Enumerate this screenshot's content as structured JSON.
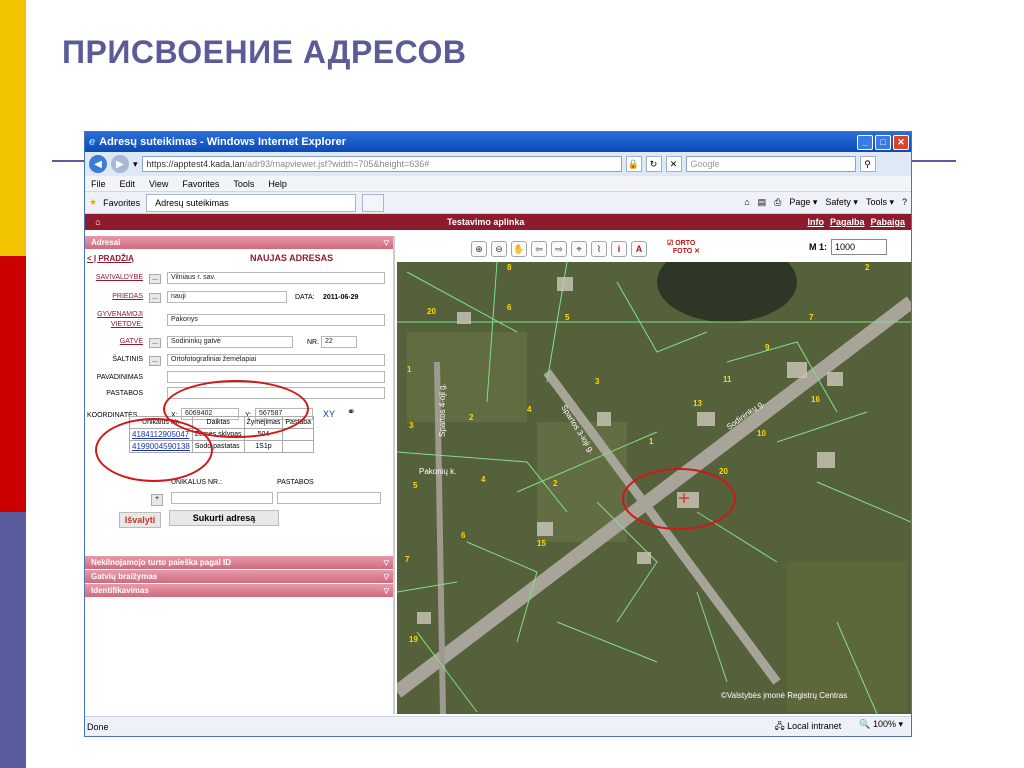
{
  "slide": {
    "title": "ПРИСВОЕНИЕ АДРЕСОВ"
  },
  "browser": {
    "window_title": "Adresų suteikimas - Windows Internet Explorer",
    "url_main": "https://apptest4.kada.lan",
    "url_rest": "/adr93/mapviewer.jsf?width=705&height=636#",
    "search_placeholder": "Google",
    "menu": [
      "File",
      "Edit",
      "View",
      "Favorites",
      "Tools",
      "Help"
    ],
    "favorites_label": "Favorites",
    "tab_title": "Adresų suteikimas",
    "commands": [
      "Page ▾",
      "Safety ▾",
      "Tools ▾"
    ],
    "status_left": "Done",
    "status_zone": "Local intranet",
    "zoom": "100%"
  },
  "app": {
    "environment": "Testavimo aplinka",
    "header_links": [
      "Info",
      "Pagalba",
      "Pabaiga"
    ],
    "panels": {
      "adresai": "Adresai",
      "nekilnojamo": "Nekilnojamojo turto paieška pagal ID",
      "gatviu": "Gatvių braižymas",
      "identifikavimas": "Identifikavimas"
    },
    "form": {
      "back": "< Į PRADŽIĄ",
      "title": "NAUJAS ADRESAS",
      "savivaldybe_label": "SAVIVALDYBĖ",
      "savivaldybe_value": "Vilniaus r. sav.",
      "priedas_label": "PRIEDAS",
      "priedas_value": "nauji",
      "data_label": "DATA:",
      "data_value": "2011-06-29",
      "gyvenamoji_label_1": "GYVENAMOJI",
      "gyvenamoji_label_2": "VIETOVĖ:",
      "gyvenamoji_value": "Pakonys",
      "gatve_label": "GATVĖ",
      "gatve_value": "Sodininkų gatvė",
      "nr_label": "NR.",
      "nr_value": "22",
      "saltinis_label": "ŠALTINIS",
      "saltinis_value": "Ortofotografiniai žemėlapiai",
      "pavadinimas_label": "PAVADINIMAS",
      "pavadinimas_value": "",
      "pastabos_label": "PASTABOS",
      "pastabos_value": "",
      "koordinates_label": "KOORDINATĖS",
      "x_label": "X:",
      "x_value": "6069402",
      "y_label": "Y:",
      "y_value": "567587",
      "xy_label": "XY",
      "table_headers": [
        "Unikalus Nr.",
        "Daiktas",
        "Žymėjimas",
        "Pastaba"
      ],
      "table_rows": [
        {
          "id": "4184112905047",
          "daiktas": "Žemės sklypas",
          "zymejimas": "504",
          "pastaba": ""
        },
        {
          "id": "4199004590138",
          "daiktas": "Sodo pastatas",
          "zymejimas": "1S1p",
          "pastaba": ""
        }
      ],
      "unikalus_nr_label": "UNIKALUS NR.:",
      "pastabos2_label": "PASTABOS",
      "add_symbol": "+",
      "clear_button": "Išvalyti",
      "create_button": "Sukurti adresą"
    },
    "map": {
      "scale_label": "M 1:",
      "scale_value": "1000",
      "orto_label_1": "ORTO",
      "orto_label_2": "FOTO",
      "copyright": "©Valstybės įmonė Registrų Centras",
      "street_labels": [
        "Spartos 4-oji g.",
        "Spartos 3-ioji g.",
        "Sodininkų g.",
        "Pakonių k."
      ],
      "parcel_numbers": [
        "8",
        "20",
        "6",
        "5",
        "2",
        "7",
        "9",
        "1",
        "3",
        "11",
        "13",
        "16",
        "3",
        "2",
        "4",
        "10",
        "1",
        "5",
        "4",
        "2",
        "20",
        "6",
        "15",
        "7",
        "19"
      ]
    }
  }
}
